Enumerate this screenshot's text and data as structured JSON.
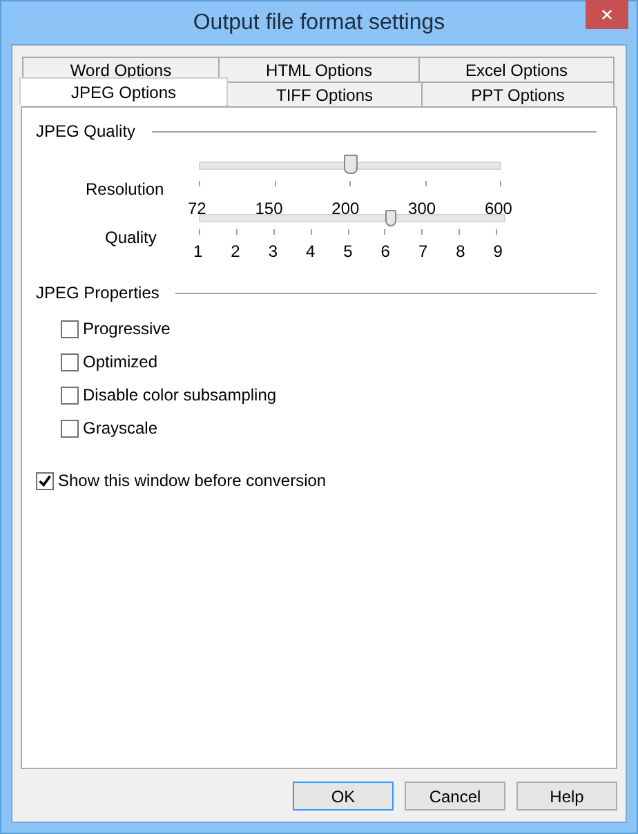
{
  "window": {
    "title": "Output file format settings",
    "close": "✕"
  },
  "tab_rows": [
    [
      {
        "label": "Word Options",
        "selected": false
      },
      {
        "label": "HTML Options",
        "selected": false
      },
      {
        "label": "Excel Options",
        "selected": false
      }
    ],
    [
      {
        "label": "JPEG Options",
        "selected": true
      },
      {
        "label": "TIFF Options",
        "selected": false
      },
      {
        "label": "PPT Options",
        "selected": false
      }
    ]
  ],
  "jpeg_quality": {
    "heading": "JPEG Quality",
    "sliders": [
      {
        "label": "Resolution",
        "level": 0.5,
        "ticks": [
          "72",
          "150",
          "200",
          "300",
          "600"
        ]
      },
      {
        "label": "Quality",
        "level": 0.625,
        "ticks": [
          "1",
          "2",
          "3",
          "4",
          "5",
          "6",
          "7",
          "8",
          "9"
        ]
      }
    ]
  },
  "jpeg_properties": {
    "heading": "JPEG Properties",
    "options": [
      {
        "label": "Progressive",
        "checked": false
      },
      {
        "label": "Optimized",
        "checked": false
      },
      {
        "label": "Disable color subsampling",
        "checked": false
      },
      {
        "label": "Grayscale",
        "checked": false
      }
    ]
  },
  "show_window": {
    "label": "Show this window before conversion",
    "checked": true
  },
  "buttons": [
    {
      "label": "OK",
      "default": true
    },
    {
      "label": "Cancel",
      "default": false
    },
    {
      "label": "Help",
      "default": false
    }
  ]
}
